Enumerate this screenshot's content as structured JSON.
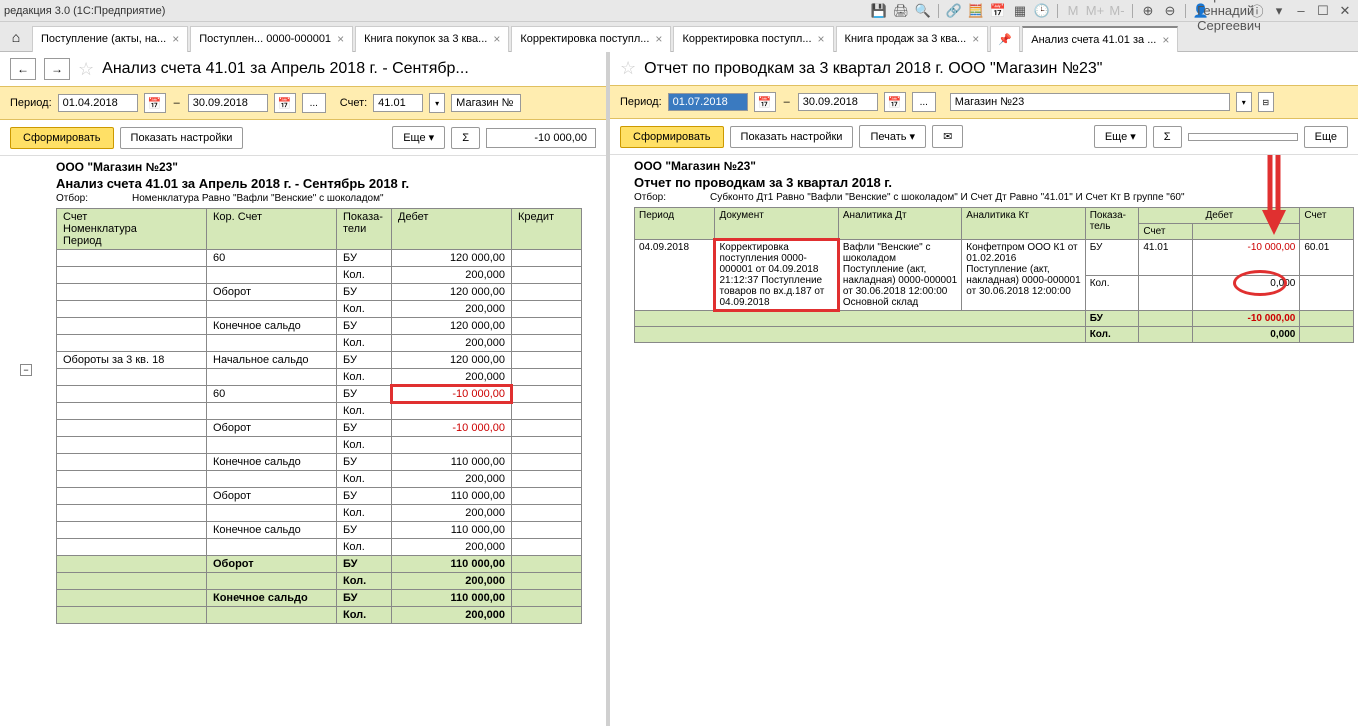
{
  "titlebar": {
    "text": "редакция 3.0 (1С:Предприятие)",
    "username": "Абрамов Геннадий Сергеевич"
  },
  "tabs": [
    {
      "label": "Поступление (акты, на...",
      "active": false
    },
    {
      "label": "Поступлен... 0000-000001",
      "active": false
    },
    {
      "label": "Книга покупок за 3 ква...",
      "active": false
    },
    {
      "label": "Корректировка поступл...",
      "active": false
    },
    {
      "label": "Корректировка поступл...",
      "active": false
    },
    {
      "label": "Книга продаж за 3 ква...",
      "active": false
    },
    {
      "label": "",
      "pinned": true
    },
    {
      "label": "Анализ счета 41.01 за ...",
      "active": true
    }
  ],
  "left": {
    "title": "Анализ счета 41.01 за Апрель 2018 г. - Сентябр...",
    "period_from": "01.04.2018",
    "period_to": "30.09.2018",
    "account_label": "Счет:",
    "account": "41.01",
    "org": "Магазин №",
    "btn_form": "Сформировать",
    "btn_settings": "Показать настройки",
    "btn_more": "Еще",
    "amount": "-10 000,00",
    "report": {
      "org": "ООО \"Магазин №23\"",
      "title": "Анализ счета 41.01 за Апрель 2018 г. - Сентябрь 2018 г.",
      "filter_label": "Отбор:",
      "filter": "Номенклатура Равно \"Вафли \"Венские\" с шоколадом\"",
      "headers": {
        "h1": "Счет",
        "h2": "Кор. Счет",
        "h3": "Показа-\nтели",
        "h4": "Дебет",
        "h5": "Кредит",
        "h1b": "Номенклатура",
        "h1c": "Период"
      },
      "rows": [
        {
          "c2": "60",
          "c3": "БУ",
          "c4": "120 000,00"
        },
        {
          "c3": "Кол.",
          "c4": "200,000"
        },
        {
          "c2": "Оборот",
          "c3": "БУ",
          "c4": "120 000,00"
        },
        {
          "c3": "Кол.",
          "c4": "200,000"
        },
        {
          "c2": "Конечное сальдо",
          "c3": "БУ",
          "c4": "120 000,00"
        },
        {
          "c3": "Кол.",
          "c4": "200,000"
        },
        {
          "c1": "Обороты за 3 кв. 18",
          "c2": "Начальное сальдо",
          "c3": "БУ",
          "c4": "120 000,00"
        },
        {
          "c3": "Кол.",
          "c4": "200,000"
        },
        {
          "c2": "60",
          "c3": "БУ",
          "c4": "-10 000,00",
          "neg": true,
          "hl": true
        },
        {
          "c3": "Кол."
        },
        {
          "c2": "Оборот",
          "c3": "БУ",
          "c4": "-10 000,00",
          "neg": true
        },
        {
          "c3": "Кол."
        },
        {
          "c2": "Конечное сальдо",
          "c3": "БУ",
          "c4": "110 000,00"
        },
        {
          "c3": "Кол.",
          "c4": "200,000"
        },
        {
          "c2": "Оборот",
          "c3": "БУ",
          "c4": "110 000,00"
        },
        {
          "c3": "Кол.",
          "c4": "200,000"
        },
        {
          "c2": "Конечное сальдо",
          "c3": "БУ",
          "c4": "110 000,00"
        },
        {
          "c3": "Кол.",
          "c4": "200,000"
        }
      ],
      "totals": [
        {
          "c2": "Оборот",
          "c3": "БУ",
          "c4": "110 000,00"
        },
        {
          "c3": "Кол.",
          "c4": "200,000"
        },
        {
          "c2": "Конечное сальдо",
          "c3": "БУ",
          "c4": "110 000,00"
        },
        {
          "c3": "Кол.",
          "c4": "200,000"
        }
      ]
    }
  },
  "right": {
    "title": "Отчет по проводкам за 3 квартал 2018 г. ООО \"Магазин №23\"",
    "period_from": "01.07.2018",
    "period_to": "30.09.2018",
    "org": "Магазин №23",
    "btn_form": "Сформировать",
    "btn_settings": "Показать настройки",
    "btn_print": "Печать",
    "btn_more": "Еще",
    "btn_more2": "Еще",
    "report": {
      "org": "ООО \"Магазин №23\"",
      "title": "Отчет по проводкам за 3 квартал 2018 г.",
      "filter_label": "Отбор:",
      "filter": "Субконто Дт1 Равно \"Вафли \"Венские\" с шоколадом\" И Счет Дт Равно \"41.01\" И Счет Кт В группе \"60\"",
      "headers": {
        "h1": "Период",
        "h2": "Документ",
        "h3": "Аналитика Дт",
        "h4": "Аналитика Кт",
        "h5": "Показа-\nтель",
        "h6": "Дебет",
        "h6a": "Счет",
        "h7": "Счет"
      },
      "row": {
        "period": "04.09.2018",
        "doc": "Корректировка поступления 0000-000001 от 04.09.2018 21:12:37 Поступление товаров по вх.д.187 от 04.09.2018",
        "adt": "Вафли \"Венские\" с шоколадом\nПоступление (акт, накладная) 0000-000001 от 30.06.2018 12:00:00\nОсновной склад",
        "akt": "Конфетпром ООО К1 от 01.02.2016\nПоступление (акт, накладная) 0000-000001 от 30.06.2018 12:00:00",
        "ind_bu": "БУ",
        "ind_kol": "Кол.",
        "acct": "41.01",
        "debit_bu": "-10 000,00",
        "debit_kol": "0,000",
        "acct2": "60.01"
      },
      "totals": {
        "bu": "БУ",
        "kol": "Кол.",
        "v_bu": "-10 000,00",
        "v_kol": "0,000"
      }
    }
  },
  "period_label": "Период:"
}
